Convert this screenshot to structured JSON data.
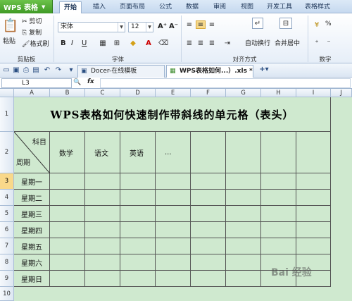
{
  "app": {
    "name": "WPS 表格"
  },
  "menu_tabs": [
    "开始",
    "插入",
    "页面布局",
    "公式",
    "数据",
    "审阅",
    "视图",
    "开发工具",
    "表格样式"
  ],
  "active_tab": "开始",
  "ribbon": {
    "clipboard": {
      "paste": "粘贴",
      "cut": "剪切",
      "copy": "复制",
      "format_painter": "格式刷",
      "group_label": "剪贴板"
    },
    "font": {
      "name": "宋体",
      "size": "12",
      "grow": "A⁺",
      "shrink": "A⁻",
      "bold": "B",
      "italic": "I",
      "underline": "U",
      "group_label": "字体"
    },
    "alignment": {
      "wrap": "自动换行",
      "merge": "合并居中",
      "group_label": "对齐方式"
    },
    "number": {
      "group_label": "数字",
      "percent": "%"
    }
  },
  "doc_tabs": [
    {
      "label": "Docer-在线模板"
    },
    {
      "label": "WPS表格如何...）.xls *"
    }
  ],
  "namebox": "L3",
  "fx": "fx",
  "columns": [
    "A",
    "B",
    "C",
    "D",
    "E",
    "F",
    "G",
    "H",
    "I",
    "J"
  ],
  "rows": [
    "1",
    "2",
    "3",
    "4",
    "5",
    "6",
    "7",
    "8",
    "9",
    "10"
  ],
  "sheet": {
    "title": "WPS表格如何快速制作带斜线的单元格（表头）",
    "diag_top": "科目",
    "diag_bottom": "周期",
    "headers": [
      "数学",
      "语文",
      "英语",
      "..."
    ],
    "days": [
      "星期一",
      "星期二",
      "星期三",
      "星期四",
      "星期五",
      "星期六",
      "星期日"
    ]
  },
  "watermark": "Bai 经验",
  "colors": {
    "grid_bg": "#cfe9cf",
    "app_green": "#4caf2e",
    "selected_header": "#f9d88a"
  }
}
